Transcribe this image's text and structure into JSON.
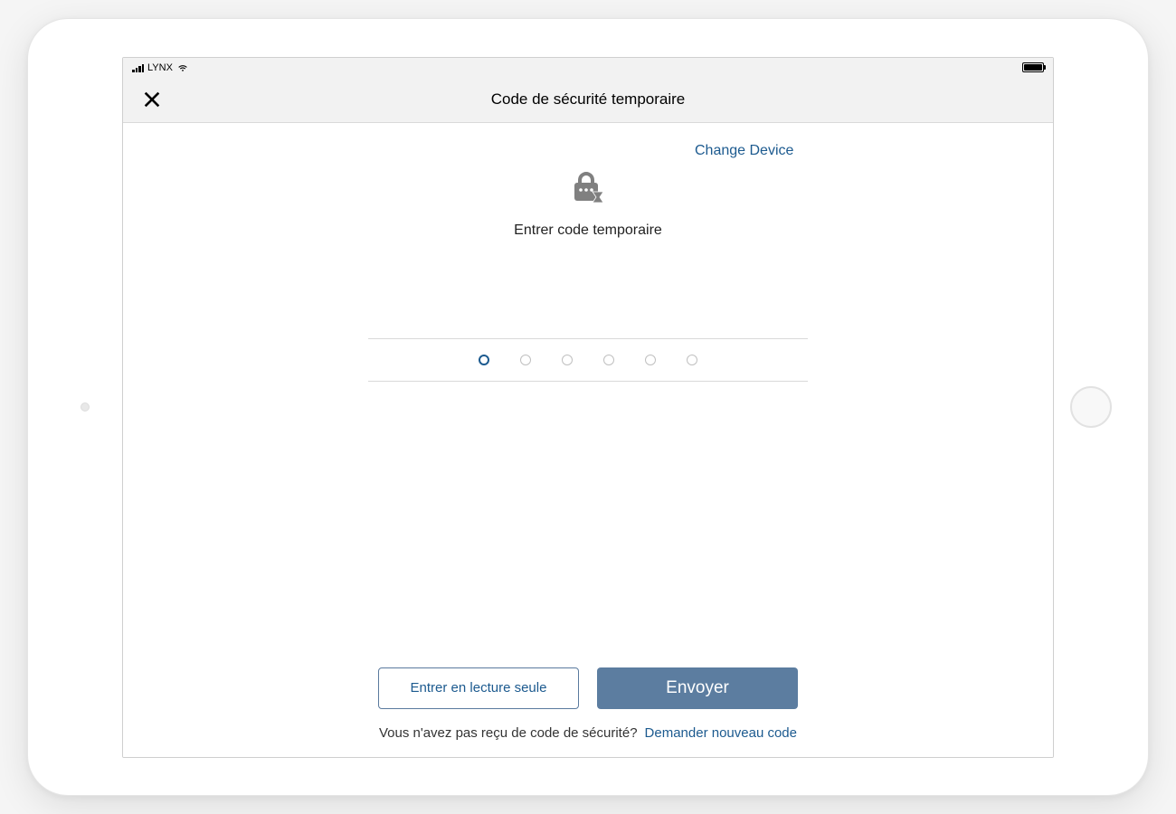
{
  "statusBar": {
    "carrier": "LYNX"
  },
  "navBar": {
    "title": "Code de sécurité temporaire"
  },
  "content": {
    "changeDeviceLabel": "Change Device",
    "promptText": "Entrer code temporaire",
    "codeLength": 6,
    "activeIndex": 0
  },
  "footer": {
    "readOnlyLabel": "Entrer en lecture seule",
    "submitLabel": "Envoyer",
    "helpText": "Vous n'avez pas reçu de code de sécurité?",
    "helpLinkLabel": "Demander nouveau code"
  },
  "colors": {
    "accent": "#1c5a8f",
    "buttonSolid": "#5c7da0"
  }
}
